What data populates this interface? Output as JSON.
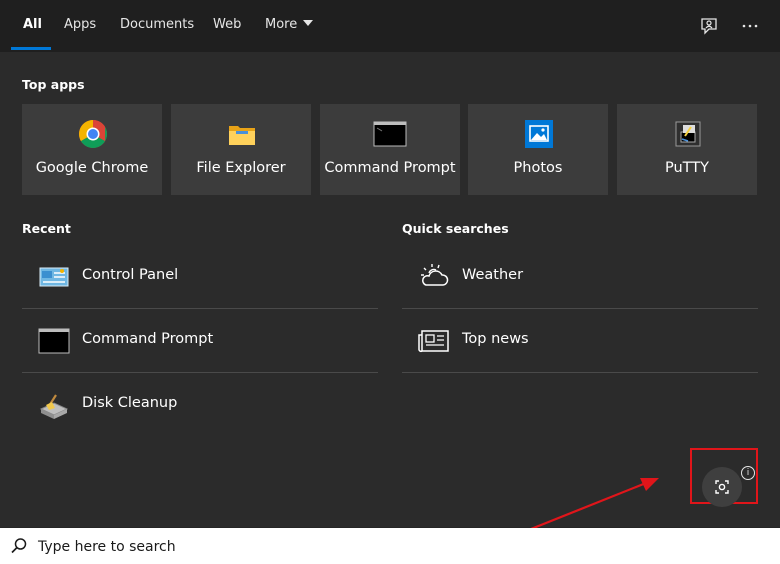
{
  "tabs": [
    {
      "label": "All",
      "active": true
    },
    {
      "label": "Apps"
    },
    {
      "label": "Documents"
    },
    {
      "label": "Web"
    },
    {
      "label": "More"
    }
  ],
  "top_apps": {
    "title": "Top apps",
    "items": [
      {
        "label": "Google Chrome",
        "icon": "chrome-icon"
      },
      {
        "label": "File Explorer",
        "icon": "folder-icon"
      },
      {
        "label": "Command Prompt",
        "icon": "terminal-icon"
      },
      {
        "label": "Photos",
        "icon": "photos-icon"
      },
      {
        "label": "PuTTY",
        "icon": "putty-icon"
      }
    ]
  },
  "recent": {
    "title": "Recent",
    "items": [
      {
        "label": "Control Panel",
        "icon": "control-panel-icon"
      },
      {
        "label": "Command Prompt",
        "icon": "terminal-icon"
      },
      {
        "label": "Disk Cleanup",
        "icon": "disk-cleanup-icon"
      }
    ]
  },
  "quick_searches": {
    "title": "Quick searches",
    "items": [
      {
        "label": "Weather",
        "icon": "weather-icon"
      },
      {
        "label": "Top news",
        "icon": "news-icon"
      }
    ]
  },
  "info_glyph": "i",
  "search": {
    "placeholder": "Type here to search"
  },
  "colors": {
    "accent": "#0078d7",
    "highlight": "#e0151a",
    "tile_bg": "#3c3c3c",
    "panel_bg": "#2b2b2b"
  }
}
